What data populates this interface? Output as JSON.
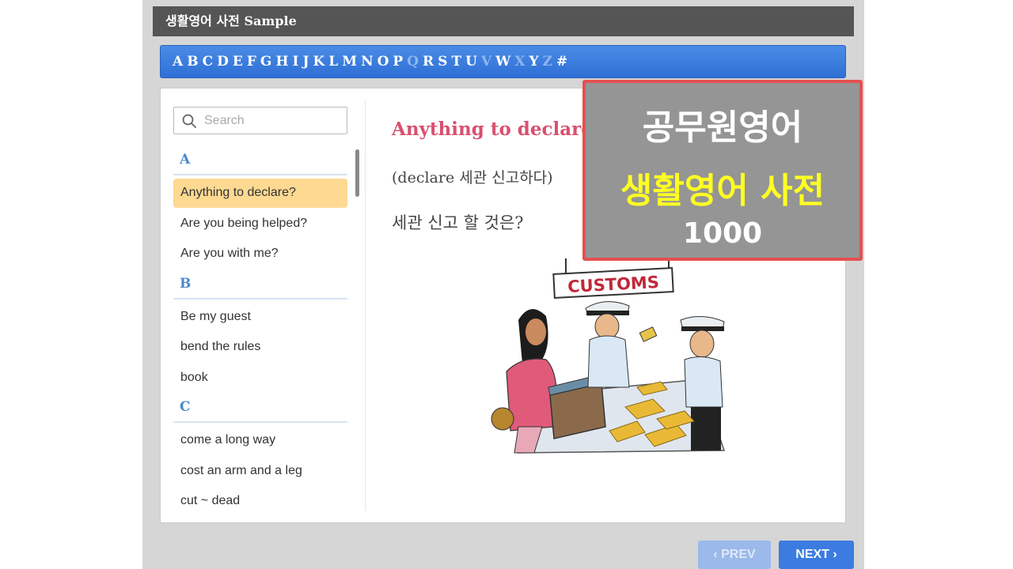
{
  "header": {
    "title_korean": "생활영어 사전",
    "title_sample": "Sample"
  },
  "alphabet": [
    {
      "char": "A",
      "enabled": true
    },
    {
      "char": "B",
      "enabled": true
    },
    {
      "char": "C",
      "enabled": true
    },
    {
      "char": "D",
      "enabled": true
    },
    {
      "char": "E",
      "enabled": true
    },
    {
      "char": "F",
      "enabled": true
    },
    {
      "char": "G",
      "enabled": true
    },
    {
      "char": "H",
      "enabled": true
    },
    {
      "char": "I",
      "enabled": true
    },
    {
      "char": "J",
      "enabled": true
    },
    {
      "char": "K",
      "enabled": true
    },
    {
      "char": "L",
      "enabled": true
    },
    {
      "char": "M",
      "enabled": true
    },
    {
      "char": "N",
      "enabled": true
    },
    {
      "char": "O",
      "enabled": true
    },
    {
      "char": "P",
      "enabled": true
    },
    {
      "char": "Q",
      "enabled": false
    },
    {
      "char": "R",
      "enabled": true
    },
    {
      "char": "S",
      "enabled": true
    },
    {
      "char": "T",
      "enabled": true
    },
    {
      "char": "U",
      "enabled": true
    },
    {
      "char": "V",
      "enabled": false
    },
    {
      "char": "W",
      "enabled": true
    },
    {
      "char": "X",
      "enabled": false
    },
    {
      "char": "Y",
      "enabled": true
    },
    {
      "char": "Z",
      "enabled": false
    },
    {
      "char": "#",
      "enabled": true
    }
  ],
  "search": {
    "placeholder": "Search",
    "value": ""
  },
  "sections": [
    {
      "letter": "A",
      "items": [
        {
          "label": "Anything to declare?",
          "active": true
        },
        {
          "label": "Are you being helped?",
          "active": false
        },
        {
          "label": "Are you with me?",
          "active": false
        }
      ]
    },
    {
      "letter": "B",
      "items": [
        {
          "label": "Be my guest",
          "active": false
        },
        {
          "label": "bend the rules",
          "active": false
        },
        {
          "label": "book",
          "active": false
        }
      ]
    },
    {
      "letter": "C",
      "items": [
        {
          "label": "come a long way",
          "active": false
        },
        {
          "label": "cost an arm and a leg",
          "active": false
        },
        {
          "label": "cut ~ dead",
          "active": false
        }
      ]
    }
  ],
  "entry": {
    "phrase": "Anything to declare?",
    "note": "(declare 세관 신고하다)",
    "meaning": "세관 신고 할 것은?",
    "sign_text": "CUSTOMS"
  },
  "overlay": {
    "line1": "공무원영어",
    "line2": "생활영어 사전",
    "line3": "1000"
  },
  "nav": {
    "prev_label": "PREV",
    "next_label": "NEXT"
  },
  "colors": {
    "accent": "#3c7ce0",
    "phrase": "#d9506e",
    "highlight": "#fdd992",
    "overlay_border": "#e55050",
    "overlay_yellow": "#ffff22"
  }
}
